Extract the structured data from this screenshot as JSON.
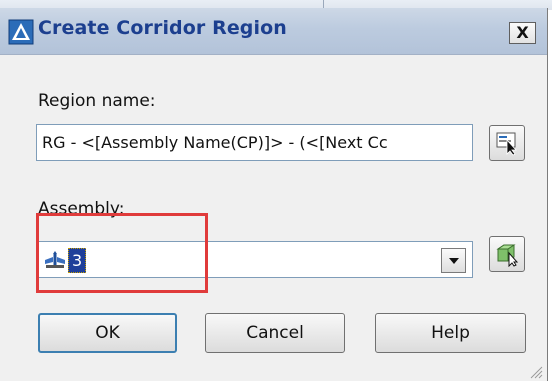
{
  "dialog": {
    "title": "Create Corridor Region",
    "close_label": "X"
  },
  "region_name": {
    "label": "Region name:",
    "value": "RG - <[Assembly Name(CP)]> - (<[Next Cc"
  },
  "assembly": {
    "label": "Assembly:",
    "selected": "3"
  },
  "buttons": {
    "ok": "OK",
    "cancel": "Cancel",
    "help": "Help"
  },
  "colors": {
    "title_text": "#1c3f8f",
    "selection": "#1f3f9a",
    "highlight": "#e03b3b"
  }
}
